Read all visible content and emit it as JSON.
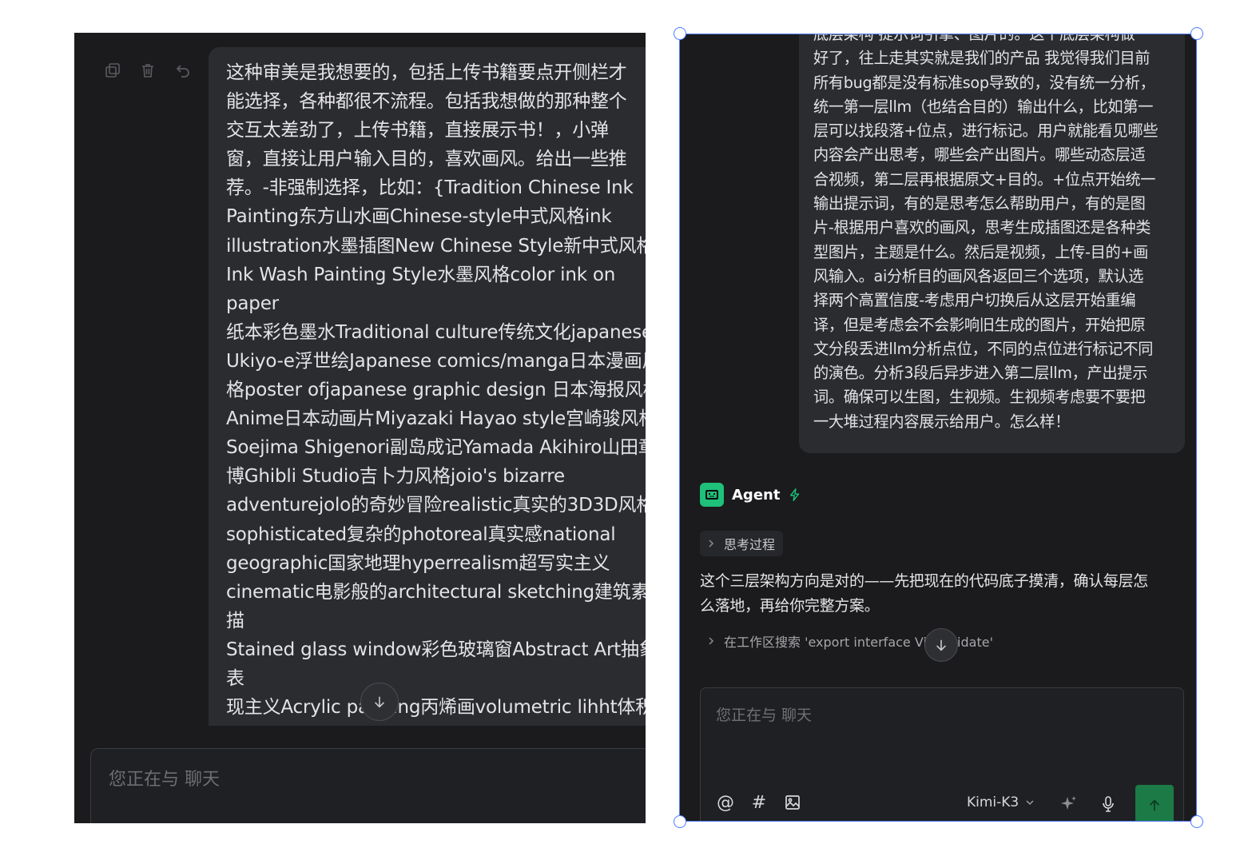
{
  "left": {
    "message": "这种审美是我想要的，包括上传书籍要点开侧栏才\n能选择，各种都很不流程。包括我想做的那种整个\n交互太差劲了，上传书籍，直接展示书！，小弹\n窗，直接让用户输入目的，喜欢画风。给出一些推\n荐。-非强制选择，比如：{Tradition Chinese Ink\nPainting东方山水画Chinese-style中式风格ink\nillustration水墨插图New Chinese Style新中式风格\nInk Wash Painting Style水墨风格color ink on paper\n纸本彩色墨水Traditional culture传统文化japanese\nUkiyo-e浮世绘Japanese comics/manga日本漫画风\n格poster ofjapanese graphic design 日本海报风格\nAnime日本动画片Miyazaki Hayao style宫崎骏风格\nSoejima Shigenori副岛成记Yamada Akihiro山田章\n博Ghibli Studio吉卜力风格joio's bizarre\nadventurejolo的奇妙冒险realistic真实的3D3D风格\nsophisticated复杂的photoreal真实感national\ngeographic国家地理hyperrealism超写实主义\ncinematic电影般的architectural sketching建筑素描\nStained glass window彩色玻璃窗Abstract Art抽象表\n现主义Acrylic painting丙烯画volumetric lihht体积法\nAmerican Country美式乡村风格Pulp Noir黑白电影\n时期Hollywood-style电影风格Disney-style迪士尼\n风}，能不用做一个网站，不要一大堆按钮 弹出内",
    "input_placeholder": "您正在与 聊天"
  },
  "right": {
    "message": "底层架构 提示词引擎、图片的。这个底层架构做\n好了，往上走其实就是我们的产品 我觉得我们目前\n所有bug都是没有标准sop导致的，没有统一分析，\n统一第一层llm（也结合目的）输出什么，比如第一\n层可以找段落+位点，进行标记。用户就能看见哪些\n内容会产出思考，哪些会产出图片。哪些动态层适\n合视频，第二层再根据原文+目的。+位点开始统一\n输出提示词，有的是思考怎么帮助用户，有的是图\n片-根据用户喜欢的画风，思考生成插图还是各种类\n型图片，主题是什么。然后是视频，上传-目的+画\n风输入。ai分析目的画风各返回三个选项，默认选\n择两个高置信度-考虑用户切换后从这层开始重编\n译，但是考虑会不会影响旧生成的图片，开始把原\n文分段丢进llm分析点位，不同的点位进行标记不同\n的演色。分析3段后异步进入第二层llm，产出提示\n词。确保可以生图，生视频。生视频考虑要不要把\n一大堆过程内容展示给用户。怎么样！",
    "agent_name": "Agent",
    "thought_label": "思考过程",
    "reply": "这个三层架构方向是对的——先把现在的代码底子摸清，确认每层怎\n么落地，再给你完整方案。",
    "tool_call": "在工作区搜索 'export interface Visi      ndidate'",
    "input_placeholder": "您正在与 聊天",
    "tool_glyphs": {
      "mention": "@",
      "hashtag": "#"
    },
    "model": "Kimi-K3",
    "colors": {
      "accent": "#1ec07a",
      "send": "#1b7a46",
      "selection": "#4d7cfe"
    }
  }
}
